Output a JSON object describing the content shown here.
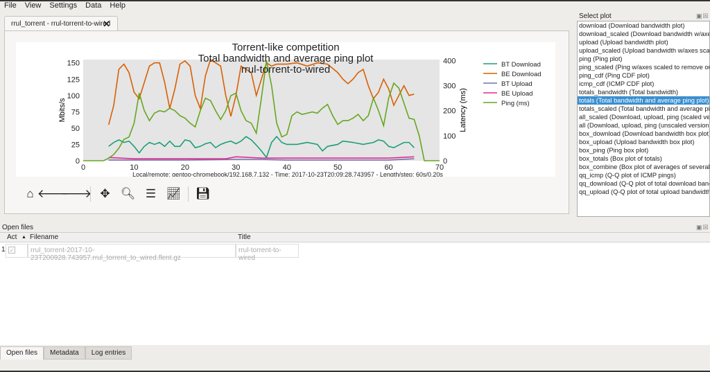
{
  "menu": [
    "File",
    "View",
    "Settings",
    "Data",
    "Help"
  ],
  "tab": {
    "label": "rrul_torrent - rrul-torrent-to-wired"
  },
  "chart_data": {
    "type": "line",
    "title": [
      "Torrent-like competition",
      "Total bandwidth and average ping plot",
      "rrul-torrent-to-wired"
    ],
    "xlabel": "",
    "ylabel": "Mbits/s",
    "y2label": "Latency (ms)",
    "xlim": [
      0,
      70
    ],
    "ylim": [
      0,
      155
    ],
    "y2lim": [
      0,
      400
    ],
    "xticks": [
      0,
      10,
      20,
      30,
      40,
      50,
      60,
      70
    ],
    "yticks": [
      0,
      25,
      50,
      75,
      100,
      125,
      150
    ],
    "y2ticks": [
      0,
      100,
      200,
      300,
      400
    ],
    "footer": "Local/remote: gentoo-chromebook/192.168.7.132 - Time: 2017-10-23T20:09:28.743957 - Length/step: 60s/0.20s",
    "legend_position": "right",
    "series": [
      {
        "name": "BT Download",
        "color": "#1b9e77",
        "axis": "left",
        "x": [
          5,
          6,
          7,
          8,
          9,
          10,
          11,
          12,
          13,
          14,
          15,
          16,
          17,
          18,
          19,
          20,
          21,
          22,
          23,
          24,
          25,
          26,
          27,
          28,
          29,
          30,
          31,
          32,
          33,
          34,
          35,
          36,
          37,
          38,
          39,
          40,
          42,
          44,
          46,
          47,
          48,
          50,
          51,
          53,
          55,
          57,
          58,
          59,
          60,
          61,
          63,
          64,
          65
        ],
        "y": [
          22,
          28,
          32,
          28,
          30,
          22,
          12,
          22,
          28,
          25,
          28,
          22,
          30,
          22,
          22,
          32,
          30,
          20,
          22,
          26,
          28,
          20,
          25,
          28,
          30,
          26,
          30,
          37,
          32,
          24,
          15,
          5,
          28,
          37,
          28,
          25,
          25,
          28,
          25,
          15,
          22,
          25,
          30,
          28,
          25,
          28,
          32,
          30,
          22,
          20,
          28,
          28,
          20
        ]
      },
      {
        "name": "BE Download",
        "color": "#d95f02",
        "axis": "left",
        "x": [
          5,
          6,
          7,
          8,
          9,
          10,
          11,
          12,
          13,
          14,
          15,
          16,
          17,
          18,
          19,
          20,
          21,
          22,
          23,
          24,
          25,
          26,
          27,
          28,
          29,
          30,
          31,
          32,
          33,
          34,
          35,
          36,
          37,
          38,
          40,
          42,
          44,
          46,
          48,
          50,
          51,
          52,
          53,
          54,
          55,
          56,
          57,
          58,
          59,
          60,
          61,
          62,
          63,
          64,
          65
        ],
        "y": [
          55,
          85,
          140,
          148,
          135,
          105,
          95,
          120,
          145,
          150,
          150,
          120,
          80,
          110,
          148,
          153,
          145,
          100,
          80,
          130,
          155,
          150,
          145,
          100,
          68,
          100,
          145,
          140,
          135,
          100,
          125,
          150,
          145,
          148,
          148,
          150,
          145,
          150,
          148,
          135,
          125,
          118,
          125,
          135,
          140,
          115,
          95,
          105,
          125,
          110,
          85,
          100,
          115,
          100,
          102
        ]
      },
      {
        "name": "BT Upload",
        "color": "#7570b3",
        "axis": "left",
        "x": [
          5,
          10,
          20,
          30,
          35,
          40,
          50,
          60,
          65
        ],
        "y": [
          1,
          1,
          1,
          2,
          2,
          1,
          1,
          1,
          3
        ]
      },
      {
        "name": "BE Upload",
        "color": "#e7298a",
        "axis": "left",
        "x": [
          5,
          10,
          20,
          28,
          30,
          35,
          40,
          50,
          60,
          65
        ],
        "y": [
          5,
          3,
          3,
          3,
          6,
          4,
          4,
          4,
          4,
          6
        ]
      },
      {
        "name": "Ping (ms)",
        "color": "#66a61e",
        "axis": "right",
        "x": [
          0,
          4,
          5,
          6,
          7,
          8,
          9,
          10,
          11,
          12,
          13,
          14,
          15,
          16,
          17,
          18,
          19,
          20,
          21,
          22,
          23,
          24,
          25,
          26,
          27,
          28,
          29,
          30,
          31,
          32,
          33,
          34,
          35,
          36,
          37,
          38,
          39,
          40,
          41,
          42,
          43,
          44,
          45,
          46,
          47,
          48,
          49,
          50,
          51,
          52,
          53,
          54,
          55,
          56,
          57,
          58,
          59,
          60,
          61,
          62,
          63,
          64,
          65,
          66,
          67,
          70
        ],
        "y": [
          0,
          0,
          10,
          25,
          50,
          85,
          95,
          150,
          270,
          200,
          160,
          190,
          200,
          195,
          210,
          200,
          180,
          170,
          150,
          135,
          200,
          250,
          240,
          200,
          165,
          200,
          260,
          270,
          200,
          160,
          150,
          110,
          250,
          400,
          300,
          150,
          95,
          105,
          180,
          195,
          185,
          190,
          195,
          190,
          210,
          225,
          180,
          145,
          160,
          160,
          170,
          185,
          160,
          180,
          250,
          200,
          140,
          250,
          310,
          290,
          230,
          170,
          165,
          100,
          0,
          0
        ]
      }
    ]
  },
  "toolbar": [
    "home-icon",
    "back-icon",
    "forward-icon",
    "pan-icon",
    "zoom-icon",
    "configure-icon",
    "edit-axis-icon",
    "save-icon"
  ],
  "select_plot": {
    "title": "Select plot",
    "selected": 9,
    "items": [
      "download (Download bandwidth plot)",
      "download_scaled (Download bandwidth w/axes scaled)",
      "upload (Upload bandwidth plot)",
      "upload_scaled (Upload bandwidth w/axes scaled)",
      "ping (Ping plot)",
      "ping_scaled (Ping w/axes scaled to remove outliers)",
      "ping_cdf (Ping CDF plot)",
      "icmp_cdf (ICMP CDF plot)",
      "totals_bandwidth (Total bandwidth)",
      "totals (Total bandwidth and average ping plot)",
      "totals_scaled (Total bandwidth and average ping plot)",
      "all_scaled (Download, upload, ping (scaled versions))",
      "all (Download, upload, ping (unscaled versions))",
      "box_download (Download bandwidth box plot)",
      "box_upload (Upload bandwidth box plot)",
      "box_ping (Ping box plot)",
      "box_totals (Box plot of totals)",
      "box_combine (Box plot of averages of several data files)",
      "qq_icmp (Q-Q plot of ICMP pings)",
      "qq_download (Q-Q plot of total download bandwidth)",
      "qq_upload (Q-Q plot of total upload bandwidth)"
    ]
  },
  "open_files": {
    "title": "Open files",
    "headers": {
      "act": "Act",
      "filename": "Filename",
      "title": "Title"
    },
    "rows": [
      {
        "num": "1",
        "active": true,
        "filename": "rrul_torrent-2017-10-23T200928.743957.rrul_torrent_to_wired.flent.gz",
        "title": "rrul-torrent-to-wired"
      }
    ]
  },
  "bottom_tabs": [
    "Open files",
    "Metadata",
    "Log entries"
  ]
}
